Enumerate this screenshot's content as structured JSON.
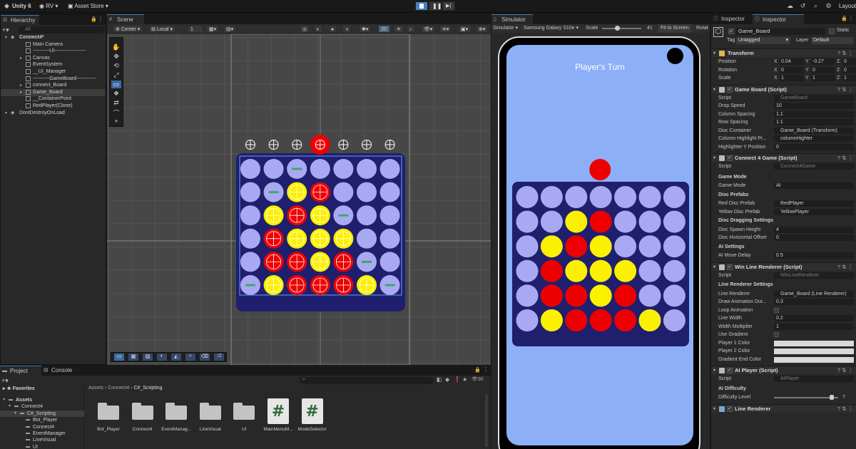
{
  "toolbar": {
    "app_name": "Unity 6",
    "account": "RV",
    "asset_store": "Asset Store",
    "layout": "Layout"
  },
  "hierarchy": {
    "tab": "Hierarchy",
    "search_placeholder": "All",
    "items": [
      {
        "label": "Connect4*",
        "depth": 0,
        "kind": "scene"
      },
      {
        "label": "Main Camera",
        "depth": 2,
        "kind": "obj"
      },
      {
        "label": "----------UI-------------------",
        "depth": 2,
        "kind": "obj"
      },
      {
        "label": "Canvas",
        "depth": 2,
        "kind": "obj"
      },
      {
        "label": "EventSystem",
        "depth": 2,
        "kind": "obj"
      },
      {
        "label": "__UI_Manager",
        "depth": 2,
        "kind": "obj"
      },
      {
        "label": "----------GameBoard------------",
        "depth": 2,
        "kind": "obj"
      },
      {
        "label": "connect_Board",
        "depth": 2,
        "kind": "obj"
      },
      {
        "label": "Game_Board",
        "depth": 2,
        "kind": "obj",
        "selected": true
      },
      {
        "label": "__ContainerPoint",
        "depth": 2,
        "kind": "obj"
      },
      {
        "label": "RedPlayer(Clone)",
        "depth": 2,
        "kind": "obj"
      },
      {
        "label": "DontDestroyOnLoad",
        "depth": 0,
        "kind": "scene"
      }
    ]
  },
  "scene": {
    "tab": "Scene",
    "pivot": "Center",
    "space": "Local",
    "snap": "1",
    "mode_2d": "2D"
  },
  "simulator": {
    "tab": "Simulator",
    "mode": "Simulator",
    "device": "Samsung Galaxy S10e",
    "scale_label": "Scale",
    "scale_value": "41",
    "fit": "Fit to Screen",
    "rotate": "Rotat",
    "turn_text": "Player's Turn"
  },
  "board": {
    "rows": [
      [
        "e",
        "e",
        "e",
        "e",
        "e",
        "e",
        "e"
      ],
      [
        "e",
        "e",
        "y",
        "r",
        "e",
        "e",
        "e"
      ],
      [
        "e",
        "y",
        "r",
        "y",
        "e",
        "e",
        "e"
      ],
      [
        "e",
        "r",
        "y",
        "y",
        "y",
        "e",
        "e"
      ],
      [
        "e",
        "r",
        "r",
        "y",
        "r",
        "e",
        "e"
      ],
      [
        "e",
        "y",
        "r",
        "r",
        "r",
        "y",
        "e"
      ]
    ],
    "scene_drop_column": 3,
    "sim_drop_column": 3,
    "colors": {
      "empty": "#a9a9f3",
      "red": "#ee0000",
      "yellow": "#fbf000",
      "board": "#1f1f6e",
      "screen": "#8daff8"
    }
  },
  "project": {
    "tab_project": "Project",
    "tab_console": "Console",
    "favorites": "Favorites",
    "count": "30",
    "breadcrumb": [
      "Assets",
      "Connect4",
      "C#_Scripting"
    ],
    "tree": [
      {
        "label": "Assets",
        "depth": 0
      },
      {
        "label": "Connect4",
        "depth": 1
      },
      {
        "label": "C#_Scripting",
        "depth": 2,
        "selected": true
      },
      {
        "label": "Bot_Player",
        "depth": 3
      },
      {
        "label": "Connect4",
        "depth": 3
      },
      {
        "label": "EventManager",
        "depth": 3
      },
      {
        "label": "LineVisual",
        "depth": 3
      },
      {
        "label": "UI",
        "depth": 3
      }
    ],
    "assets": [
      {
        "label": "Bot_Player",
        "kind": "folder"
      },
      {
        "label": "Connect4",
        "kind": "folder"
      },
      {
        "label": "EventManag...",
        "kind": "folder"
      },
      {
        "label": "LineVisual",
        "kind": "folder"
      },
      {
        "label": "UI",
        "kind": "folder"
      },
      {
        "label": "MainMenuM...",
        "kind": "script"
      },
      {
        "label": "ModeSelector",
        "kind": "script"
      }
    ]
  },
  "inspector": {
    "tab1": "Inspector",
    "tab2": "Inspector",
    "object_name": "Game_Board",
    "static_label": "Static",
    "tag_label": "Tag",
    "tag_value": "Untagged",
    "layer_label": "Layer",
    "layer_value": "Default",
    "transform": {
      "title": "Transform",
      "position": {
        "label": "Position",
        "x": "0.04",
        "y": "-0.27",
        "z": "0"
      },
      "rotation": {
        "label": "Rotation",
        "x": "0",
        "y": "0",
        "z": "0"
      },
      "scale": {
        "label": "Scale",
        "x": "1",
        "y": "1",
        "z": "1"
      }
    },
    "game_board": {
      "title": "Game Board (Script)",
      "script_label": "Script",
      "script_value": "GameBoard",
      "fields": [
        {
          "label": "Drop Speed",
          "value": "10"
        },
        {
          "label": "Column Spacing",
          "value": "1.1"
        },
        {
          "label": "Row Spacing",
          "value": "1.1"
        },
        {
          "label": "Disc Container",
          "value": "Game_Board (Transform)"
        },
        {
          "label": "Column Highlight Pr...",
          "value": "columnHighter"
        },
        {
          "label": "Highlighter Y Position",
          "value": "0"
        }
      ]
    },
    "connect4": {
      "title": "Connect 4 Game (Script)",
      "script_label": "Script",
      "script_value": "Connect4Game",
      "sec_mode": "Game Mode",
      "mode_label": "Game Mode",
      "mode_value": "AI",
      "sec_prefabs": "Disc Prefabs",
      "red_label": "Red Disc Prefab",
      "red_value": "RedPlayer",
      "yellow_label": "Yellow Disc Prefab",
      "yellow_value": "YellowPlayer",
      "sec_drag": "Disc Dragging Settings",
      "spawn_label": "Disc Spawn Height",
      "spawn_value": "4",
      "offset_label": "Disc Horizontal Offset",
      "offset_value": "0",
      "sec_ai": "AI Settings",
      "delay_label": "AI Move Delay",
      "delay_value": "0.5"
    },
    "win_line": {
      "title": "Win Line Renderer (Script)",
      "script_label": "Script",
      "script_value": "WinLineRenderer",
      "sec": "Line Renderer Settings",
      "lr_label": "Line Renderer",
      "lr_value": "Game_Board (Line Renderer)",
      "dur_label": "Draw Animation Dur...",
      "dur_value": "0.3",
      "loop_label": "Loop Animation",
      "width_label": "Line Width",
      "width_value": "0.2",
      "mult_label": "Width Multiplier",
      "mult_value": "1",
      "grad_label": "Use Gradient",
      "p1_label": "Player 1 Color",
      "p2_label": "Player 2 Color",
      "ge_label": "Gradient End Color"
    },
    "ai_player": {
      "title": "AI Player (Script)",
      "script_label": "Script",
      "script_value": "AIPlayer",
      "sec": "AI Difficulty",
      "diff_label": "Difficulty Level",
      "diff_value": "7",
      "diff_fraction": 0.9
    },
    "line_renderer": {
      "title": "Line Renderer"
    }
  }
}
